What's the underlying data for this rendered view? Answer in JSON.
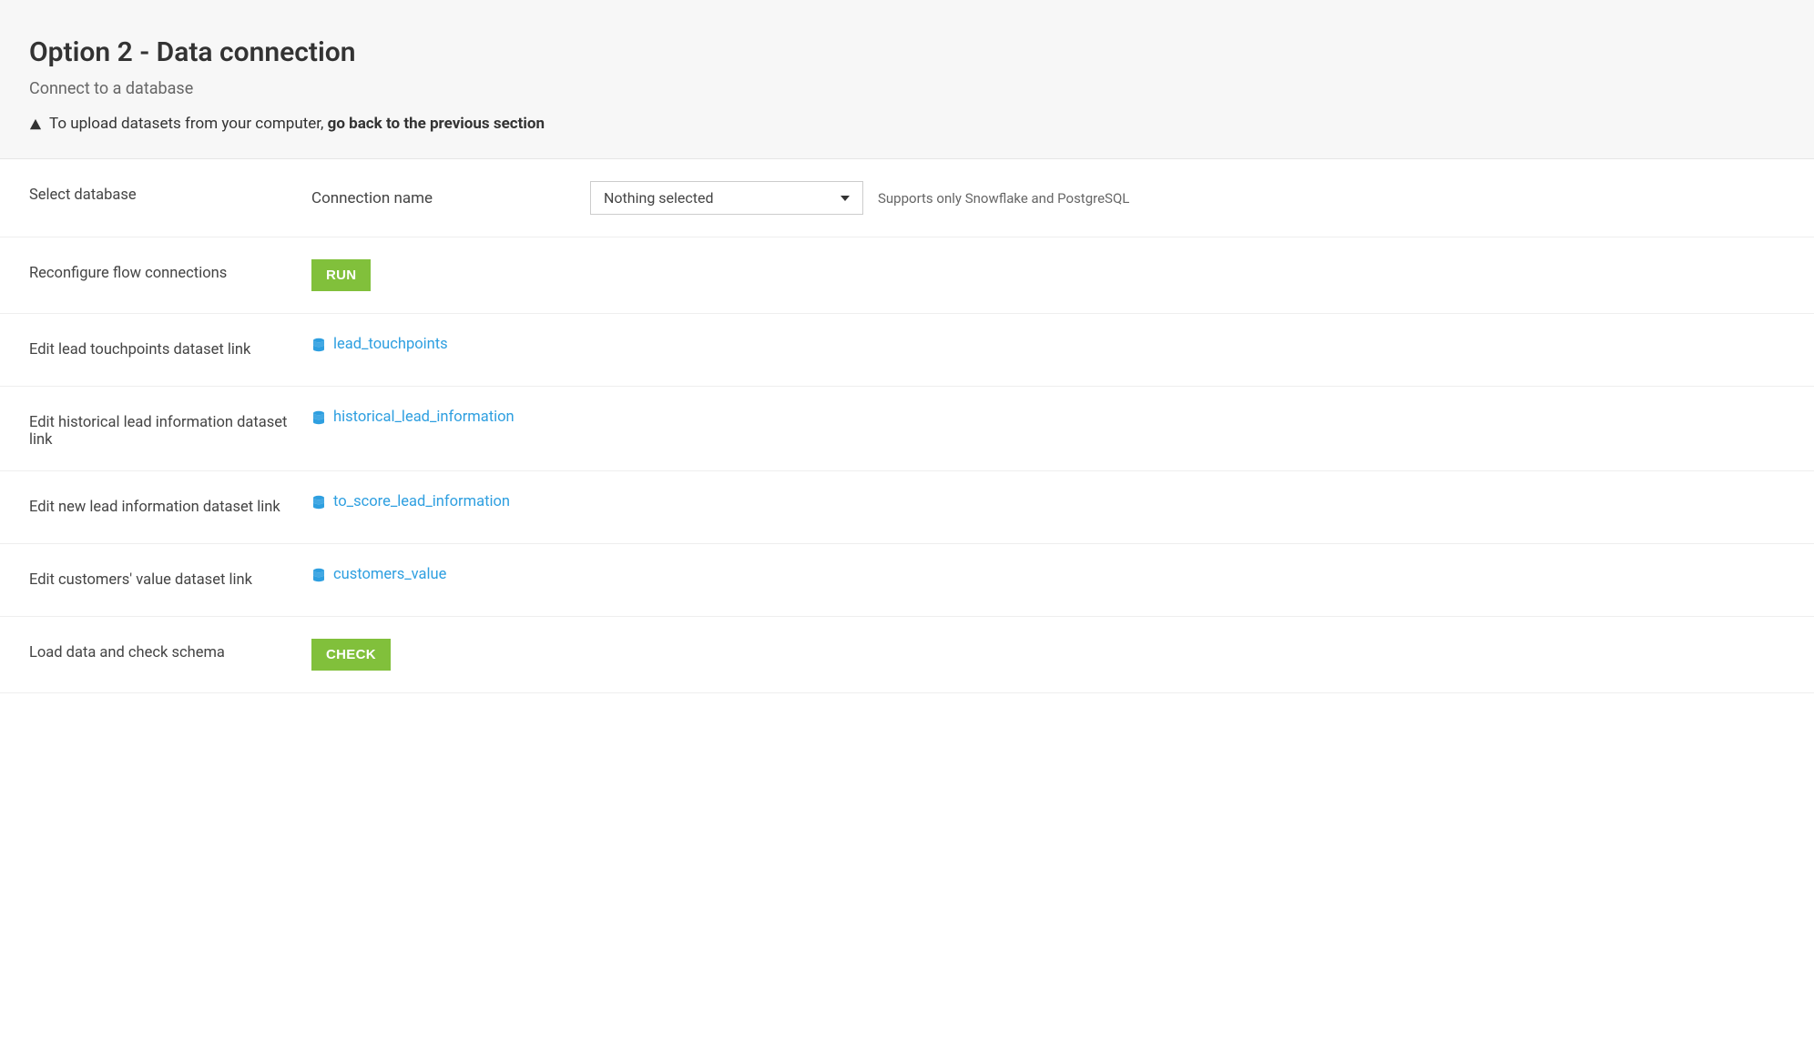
{
  "header": {
    "title": "Option 2 - Data connection",
    "subtitle": "Connect to a database",
    "warning_prefix": "To upload datasets from your computer, ",
    "warning_bold": "go back to the previous section"
  },
  "select_db": {
    "label": "Select database",
    "sub_label": "Connection name",
    "selected": "Nothing selected",
    "help": "Supports only Snowflake and PostgreSQL"
  },
  "reconfigure": {
    "label": "Reconfigure flow connections",
    "button": "RUN"
  },
  "datasets": [
    {
      "label": "Edit lead touchpoints dataset link",
      "link": "lead_touchpoints"
    },
    {
      "label": "Edit historical lead information dataset link",
      "link": "historical_lead_information"
    },
    {
      "label": "Edit new lead information dataset link",
      "link": "to_score_lead_information"
    },
    {
      "label": "Edit customers' value dataset link",
      "link": "customers_value"
    }
  ],
  "load_check": {
    "label": "Load data and check schema",
    "button": "CHECK"
  }
}
